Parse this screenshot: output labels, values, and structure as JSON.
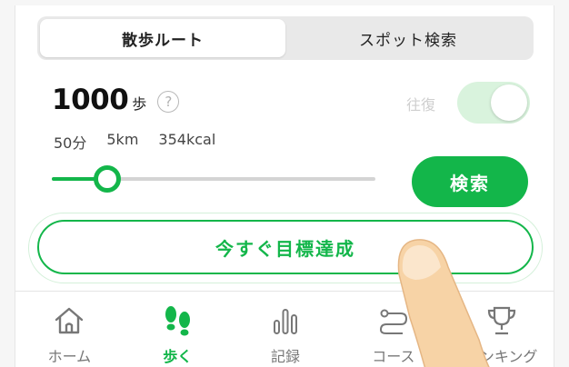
{
  "tabs": [
    {
      "label": "散歩ルート",
      "active": true
    },
    {
      "label": "スポット検索",
      "active": false
    }
  ],
  "steps": {
    "value": "1000",
    "unit": "歩",
    "help": "?"
  },
  "stats": {
    "time": "50分",
    "distance": "5km",
    "calories": "354kcal"
  },
  "roundtrip": {
    "label": "往復",
    "on": true
  },
  "slider": {
    "value_fraction": 0.17
  },
  "search_button": "検索",
  "goal_button": "今すぐ目標達成",
  "nav": [
    {
      "label": "ホーム",
      "icon": "home-icon"
    },
    {
      "label": "歩く",
      "icon": "footprints-icon",
      "active": true
    },
    {
      "label": "記録",
      "icon": "bar-chart-icon"
    },
    {
      "label": "コース",
      "icon": "course-icon"
    },
    {
      "label": "ランキング",
      "icon": "trophy-icon"
    }
  ],
  "colors": {
    "accent": "#13b64a",
    "toggle_bg": "#d9f3dd"
  }
}
